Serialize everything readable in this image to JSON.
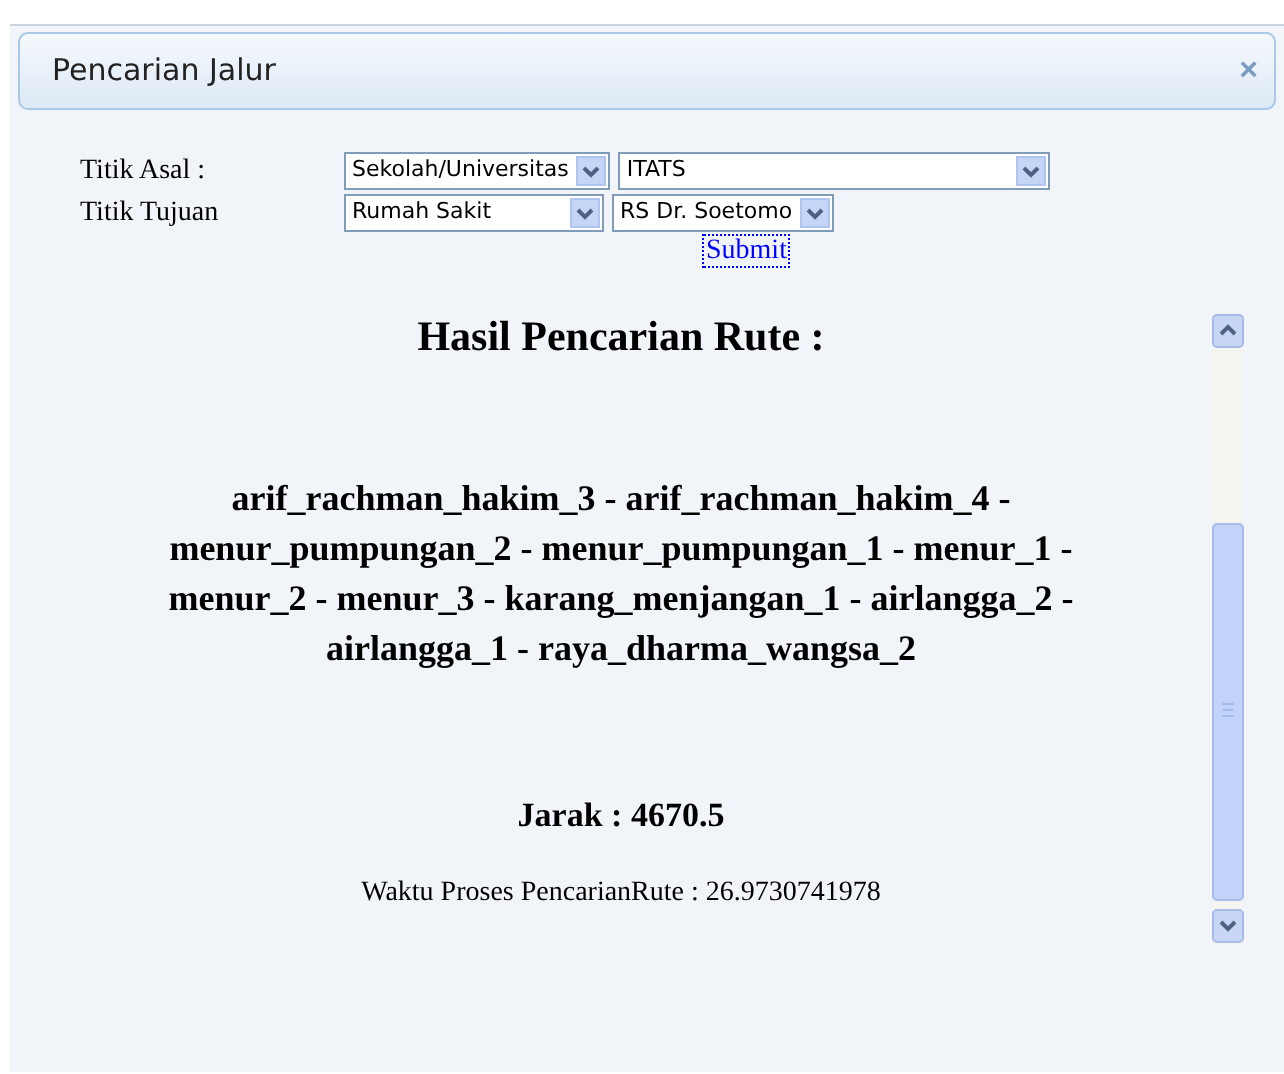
{
  "dialog": {
    "title": "Pencarian Jalur",
    "close": "×"
  },
  "form": {
    "rows": [
      {
        "label": "Titik Asal :",
        "category": "Sekolah/Universitas",
        "place": "ITATS"
      },
      {
        "label": "Titik Tujuan",
        "category": "Rumah Sakit",
        "place": "RS Dr. Soetomo"
      }
    ],
    "submit": "Submit"
  },
  "result": {
    "heading": "Hasil Pencarian Rute :",
    "route": "arif_rachman_hakim_3 - arif_rachman_hakim_4 - menur_pumpungan_2 - menur_pumpungan_1 - menur_1 - menur_2 - menur_3 - karang_menjangan_1 - airlangga_2 - airlangga_1 - raya_dharma_wangsa_2",
    "distance": "Jarak : 4670.5",
    "time": "Waktu Proses PencarianRute : 26.9730741978"
  }
}
